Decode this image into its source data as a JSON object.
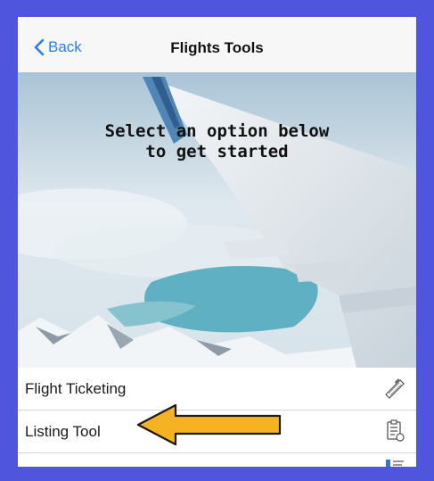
{
  "nav": {
    "back_label": "Back",
    "title": "Flights Tools"
  },
  "hero": {
    "line1": "Select an option below",
    "line2": "to get started"
  },
  "menu": {
    "items": [
      {
        "label": "Flight Ticketing",
        "icon": "ticket-plane-icon"
      },
      {
        "label": "Listing Tool",
        "icon": "clipboard-icon"
      },
      {
        "label": "",
        "icon": "list-icon"
      }
    ]
  },
  "colors": {
    "frame": "#4f55dc",
    "accent": "#2f7cf6",
    "arrow": "#f5b323"
  }
}
